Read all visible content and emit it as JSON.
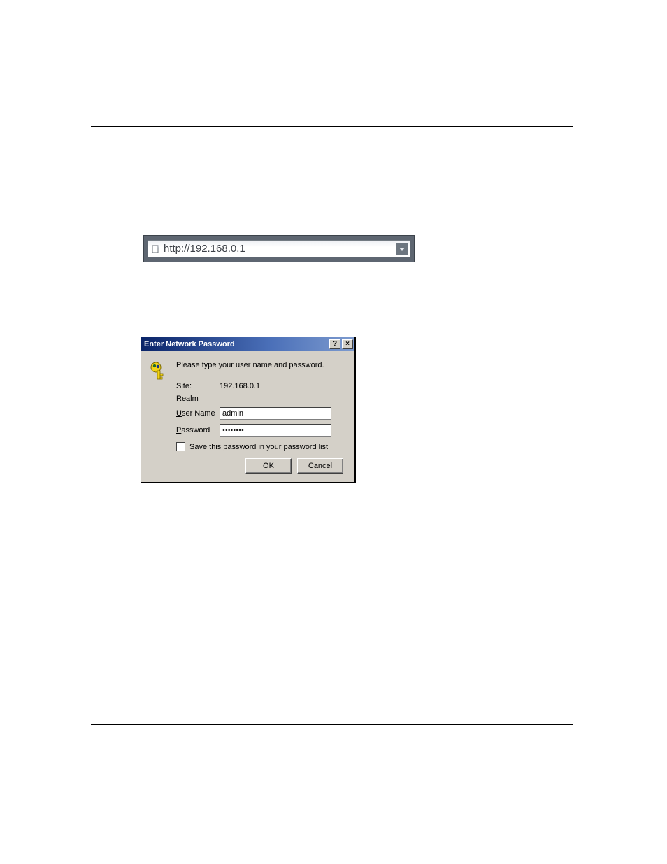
{
  "address_bar": {
    "url": "http://192.168.0.1"
  },
  "dialog": {
    "title": "Enter Network Password",
    "message": "Please type your user name and password.",
    "fields": {
      "site": {
        "label": "Site:",
        "value": "192.168.0.1"
      },
      "realm": {
        "label": "Realm",
        "value": ""
      },
      "username": {
        "label_pre": "U",
        "label_post": "ser Name",
        "value": "admin"
      },
      "password": {
        "label_pre": "P",
        "label_post": "assword",
        "value": "xxxxxxxx"
      }
    },
    "checkbox": {
      "label_pre": "S",
      "label_post": "ave this password in your password list",
      "checked": false
    },
    "buttons": {
      "ok": "OK",
      "cancel": "Cancel"
    },
    "help_btn": "?",
    "close_btn": "×"
  }
}
